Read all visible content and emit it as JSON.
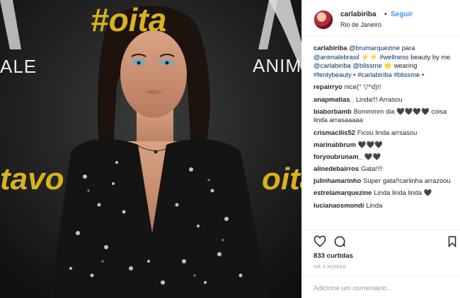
{
  "post": {
    "backdrop": {
      "top_text": "#oita",
      "left_word": "tavo",
      "right_word": "oita",
      "brand_right": "ANIMAL",
      "brand_left": "ALE"
    },
    "photo_alt": "Photo"
  },
  "header": {
    "username": "carlabiriba",
    "separator": "•",
    "follow_label": "Seguir",
    "location": "Rio de Janeiro"
  },
  "caption": {
    "username": "carlabiriba",
    "mention1": "@brumarquezine",
    "text1": " para ",
    "mention2": "@animalebrasil",
    "text2": " ⚡⚡ ",
    "tag1": "#wellness",
    "text3": " beauty by me ",
    "mention3": "@carlabiriba",
    "text4": " ",
    "mention4": "@blissme",
    "text5": " 🌟 wearing ",
    "tag2": "#fentybeauty",
    "text6": " • ",
    "tag3": "#carlabiriba",
    "text7": " ",
    "tag4": "#blissme",
    "text8": " •"
  },
  "comments": [
    {
      "user": "repairryo",
      "text": "nice(°  ▽^d)!!"
    },
    {
      "user": "anapmatias_",
      "text": "Linda!!! Arrasou"
    },
    {
      "user": "biaborbamb",
      "text": "Bommmm dia 🖤🖤🖤🖤 coisa linda arrasaaaaa"
    },
    {
      "user": "crismacilis52",
      "text": "Ficou linda arrsasou"
    },
    {
      "user": "marinabbrum",
      "text": "🖤🖤🖤"
    },
    {
      "user": "foryoubrunam_",
      "text": "🖤🖤"
    },
    {
      "user": "alinedebairros",
      "text": "Gata!!!!"
    },
    {
      "user": "julinhamarinho",
      "text": "Super gata!!carlinha arrazoou"
    },
    {
      "user": "estrelamarquezine",
      "text": "Linda linda linda 🖤"
    },
    {
      "user": "lucianaosmondi",
      "text": "Linda"
    }
  ],
  "actions": {
    "like_icon": "heart-icon",
    "comment_icon": "speech-bubble-icon",
    "save_icon": "bookmark-icon"
  },
  "likes": "833 curtidas",
  "timestamp": "HÁ 4 HORAS",
  "add_comment": {
    "placeholder": "Adicione um comentário..."
  },
  "colors": {
    "link": "#003569",
    "follow": "#3897f0",
    "muted": "#999999",
    "backdrop_gold": "#d8b21f"
  }
}
